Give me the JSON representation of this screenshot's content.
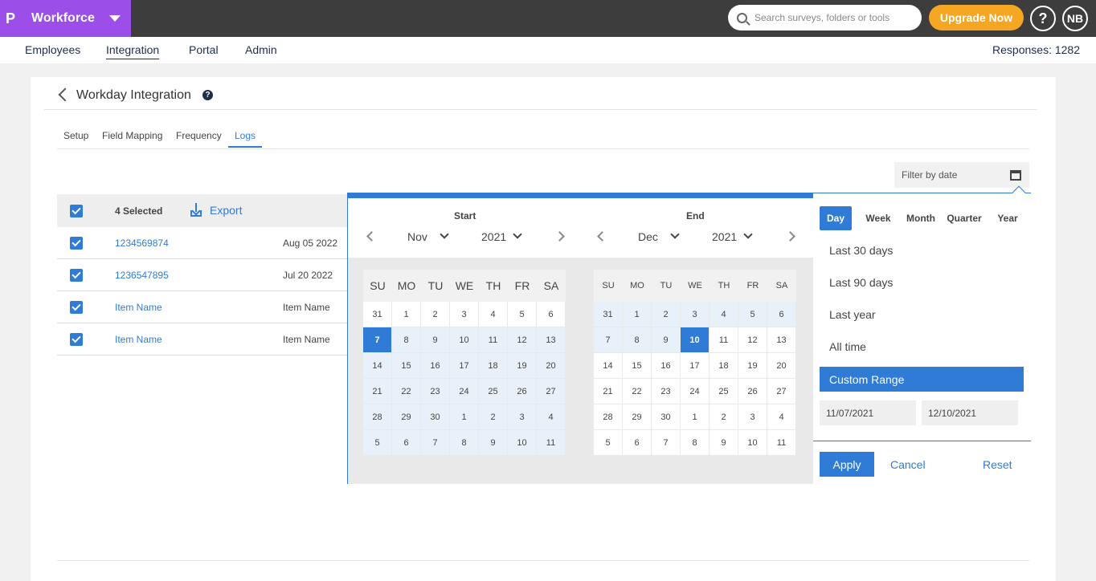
{
  "app": {
    "logo": "P",
    "name": "Workforce"
  },
  "search": {
    "placeholder": "Search surveys, folders or tools"
  },
  "header": {
    "upgrade_label": "Upgrade Now",
    "help_label": "?",
    "avatar_initials": "NB"
  },
  "nav": {
    "items": [
      "Employees",
      "Integration",
      "Portal",
      "Admin"
    ],
    "active": "Integration",
    "responses": "Responses: 1282"
  },
  "page": {
    "title": "Workday Integration",
    "help_label": "?"
  },
  "tabs": {
    "items": [
      "Setup",
      "Field Mapping",
      "Frequency",
      "Logs"
    ],
    "active": "Logs"
  },
  "filter": {
    "label": "Filter by date"
  },
  "table": {
    "selected_label": "4 Selected",
    "export_label": "Export",
    "rows": [
      {
        "link": "1234569874",
        "text": "Aug 05 2022"
      },
      {
        "link": "1236547895",
        "text": "Jul 20 2022"
      },
      {
        "link": "Item Name",
        "text": "Item Name"
      },
      {
        "link": "Item Name",
        "text": "Item Name"
      }
    ]
  },
  "datepicker": {
    "start": {
      "label": "Start",
      "month": "Nov",
      "year": "2021"
    },
    "end": {
      "label": "End",
      "month": "Dec",
      "year": "2021"
    },
    "weekdays": [
      "SU",
      "MO",
      "TU",
      "WE",
      "TH",
      "FR",
      "SA"
    ],
    "start_days": [
      [
        "31",
        "1",
        "2",
        "3",
        "4",
        "5",
        "6"
      ],
      [
        "7",
        "8",
        "9",
        "10",
        "11",
        "12",
        "13"
      ],
      [
        "14",
        "15",
        "16",
        "17",
        "18",
        "19",
        "20"
      ],
      [
        "21",
        "22",
        "23",
        "24",
        "25",
        "26",
        "27"
      ],
      [
        "28",
        "29",
        "30",
        "1",
        "2",
        "3",
        "4"
      ],
      [
        "5",
        "6",
        "7",
        "8",
        "9",
        "10",
        "11"
      ]
    ],
    "end_days": [
      [
        "31",
        "1",
        "2",
        "3",
        "4",
        "5",
        "6"
      ],
      [
        "7",
        "8",
        "9",
        "10",
        "11",
        "12",
        "13"
      ],
      [
        "14",
        "15",
        "16",
        "17",
        "18",
        "19",
        "20"
      ],
      [
        "21",
        "22",
        "23",
        "24",
        "25",
        "26",
        "27"
      ],
      [
        "28",
        "29",
        "30",
        "1",
        "2",
        "3",
        "4"
      ],
      [
        "5",
        "6",
        "7",
        "8",
        "9",
        "10",
        "11"
      ]
    ],
    "start_selected": "7",
    "end_selected": "10",
    "periods": [
      "Day",
      "Week",
      "Month",
      "Quarter",
      "Year"
    ],
    "active_period": "Day",
    "presets": [
      "Last 30 days",
      "Last 90 days",
      "Last year",
      "All time"
    ],
    "active_preset": "Custom Range",
    "from_date": "11/07/2021",
    "to_date": "12/10/2021",
    "apply_label": "Apply",
    "cancel_label": "Cancel",
    "reset_label": "Reset",
    "accent_color": "#2f7bd6"
  }
}
